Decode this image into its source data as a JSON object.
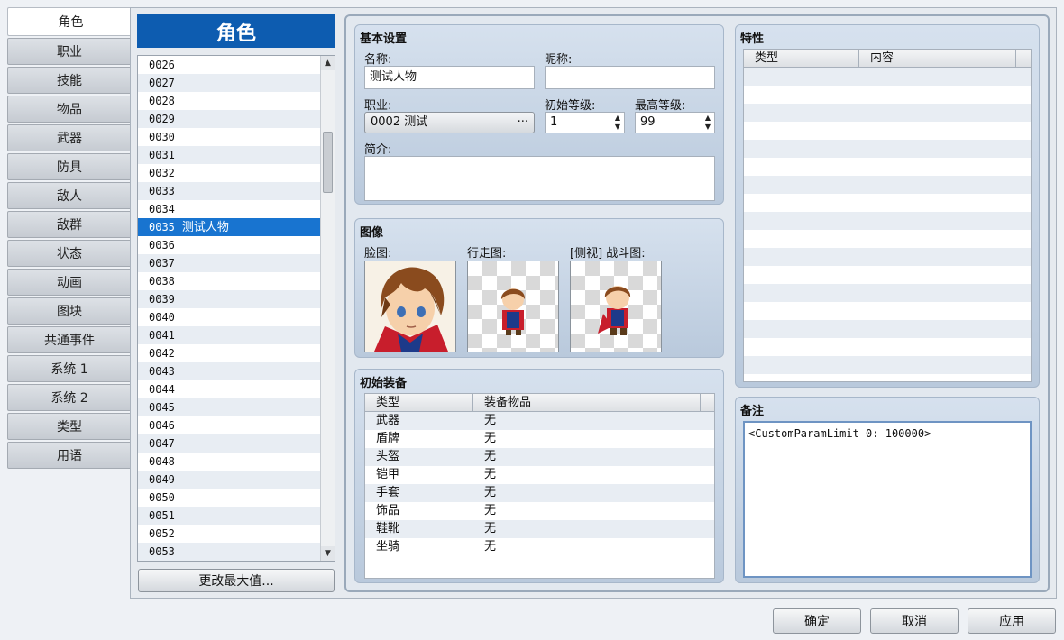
{
  "tabs": [
    "角色",
    "职业",
    "技能",
    "物品",
    "武器",
    "防具",
    "敌人",
    "敌群",
    "状态",
    "动画",
    "图块",
    "共通事件",
    "系统 1",
    "系统 2",
    "类型",
    "用语"
  ],
  "list": {
    "title": "角色",
    "items": [
      {
        "id": "0026",
        "name": ""
      },
      {
        "id": "0027",
        "name": ""
      },
      {
        "id": "0028",
        "name": ""
      },
      {
        "id": "0029",
        "name": ""
      },
      {
        "id": "0030",
        "name": ""
      },
      {
        "id": "0031",
        "name": ""
      },
      {
        "id": "0032",
        "name": ""
      },
      {
        "id": "0033",
        "name": ""
      },
      {
        "id": "0034",
        "name": ""
      },
      {
        "id": "0035",
        "name": "测试人物",
        "selected": true
      },
      {
        "id": "0036",
        "name": ""
      },
      {
        "id": "0037",
        "name": ""
      },
      {
        "id": "0038",
        "name": ""
      },
      {
        "id": "0039",
        "name": ""
      },
      {
        "id": "0040",
        "name": ""
      },
      {
        "id": "0041",
        "name": ""
      },
      {
        "id": "0042",
        "name": ""
      },
      {
        "id": "0043",
        "name": ""
      },
      {
        "id": "0044",
        "name": ""
      },
      {
        "id": "0045",
        "name": ""
      },
      {
        "id": "0046",
        "name": ""
      },
      {
        "id": "0047",
        "name": ""
      },
      {
        "id": "0048",
        "name": ""
      },
      {
        "id": "0049",
        "name": ""
      },
      {
        "id": "0050",
        "name": ""
      },
      {
        "id": "0051",
        "name": ""
      },
      {
        "id": "0052",
        "name": ""
      },
      {
        "id": "0053",
        "name": ""
      }
    ],
    "change_max_label": "更改最大值..."
  },
  "basic": {
    "title": "基本设置",
    "name_label": "名称:",
    "name_value": "测试人物",
    "nickname_label": "昵称:",
    "nickname_value": "",
    "class_label": "职业:",
    "class_value": "0002 测试",
    "class_more": "···",
    "init_level_label": "初始等级:",
    "init_level_value": "1",
    "max_level_label": "最高等级:",
    "max_level_value": "99",
    "profile_label": "简介:",
    "profile_value": ""
  },
  "images": {
    "title": "图像",
    "face_label": "脸图:",
    "walk_label": "行走图:",
    "battler_label": "[侧视] 战斗图:"
  },
  "equipment": {
    "title": "初始装备",
    "col_type": "类型",
    "col_item": "装备物品",
    "rows": [
      {
        "type": "武器",
        "item": "无"
      },
      {
        "type": "盾牌",
        "item": "无"
      },
      {
        "type": "头盔",
        "item": "无"
      },
      {
        "type": "铠甲",
        "item": "无"
      },
      {
        "type": "手套",
        "item": "无"
      },
      {
        "type": "饰品",
        "item": "无"
      },
      {
        "type": "鞋靴",
        "item": "无"
      },
      {
        "type": "坐骑",
        "item": "无"
      }
    ]
  },
  "traits": {
    "title": "特性",
    "col_type": "类型",
    "col_content": "内容"
  },
  "note": {
    "title": "备注",
    "value": "<CustomParamLimit 0: 100000>"
  },
  "buttons": {
    "ok": "确定",
    "cancel": "取消",
    "apply": "应用"
  },
  "colors": {
    "accent": "#0d5cb0",
    "selection": "#1874d0"
  }
}
